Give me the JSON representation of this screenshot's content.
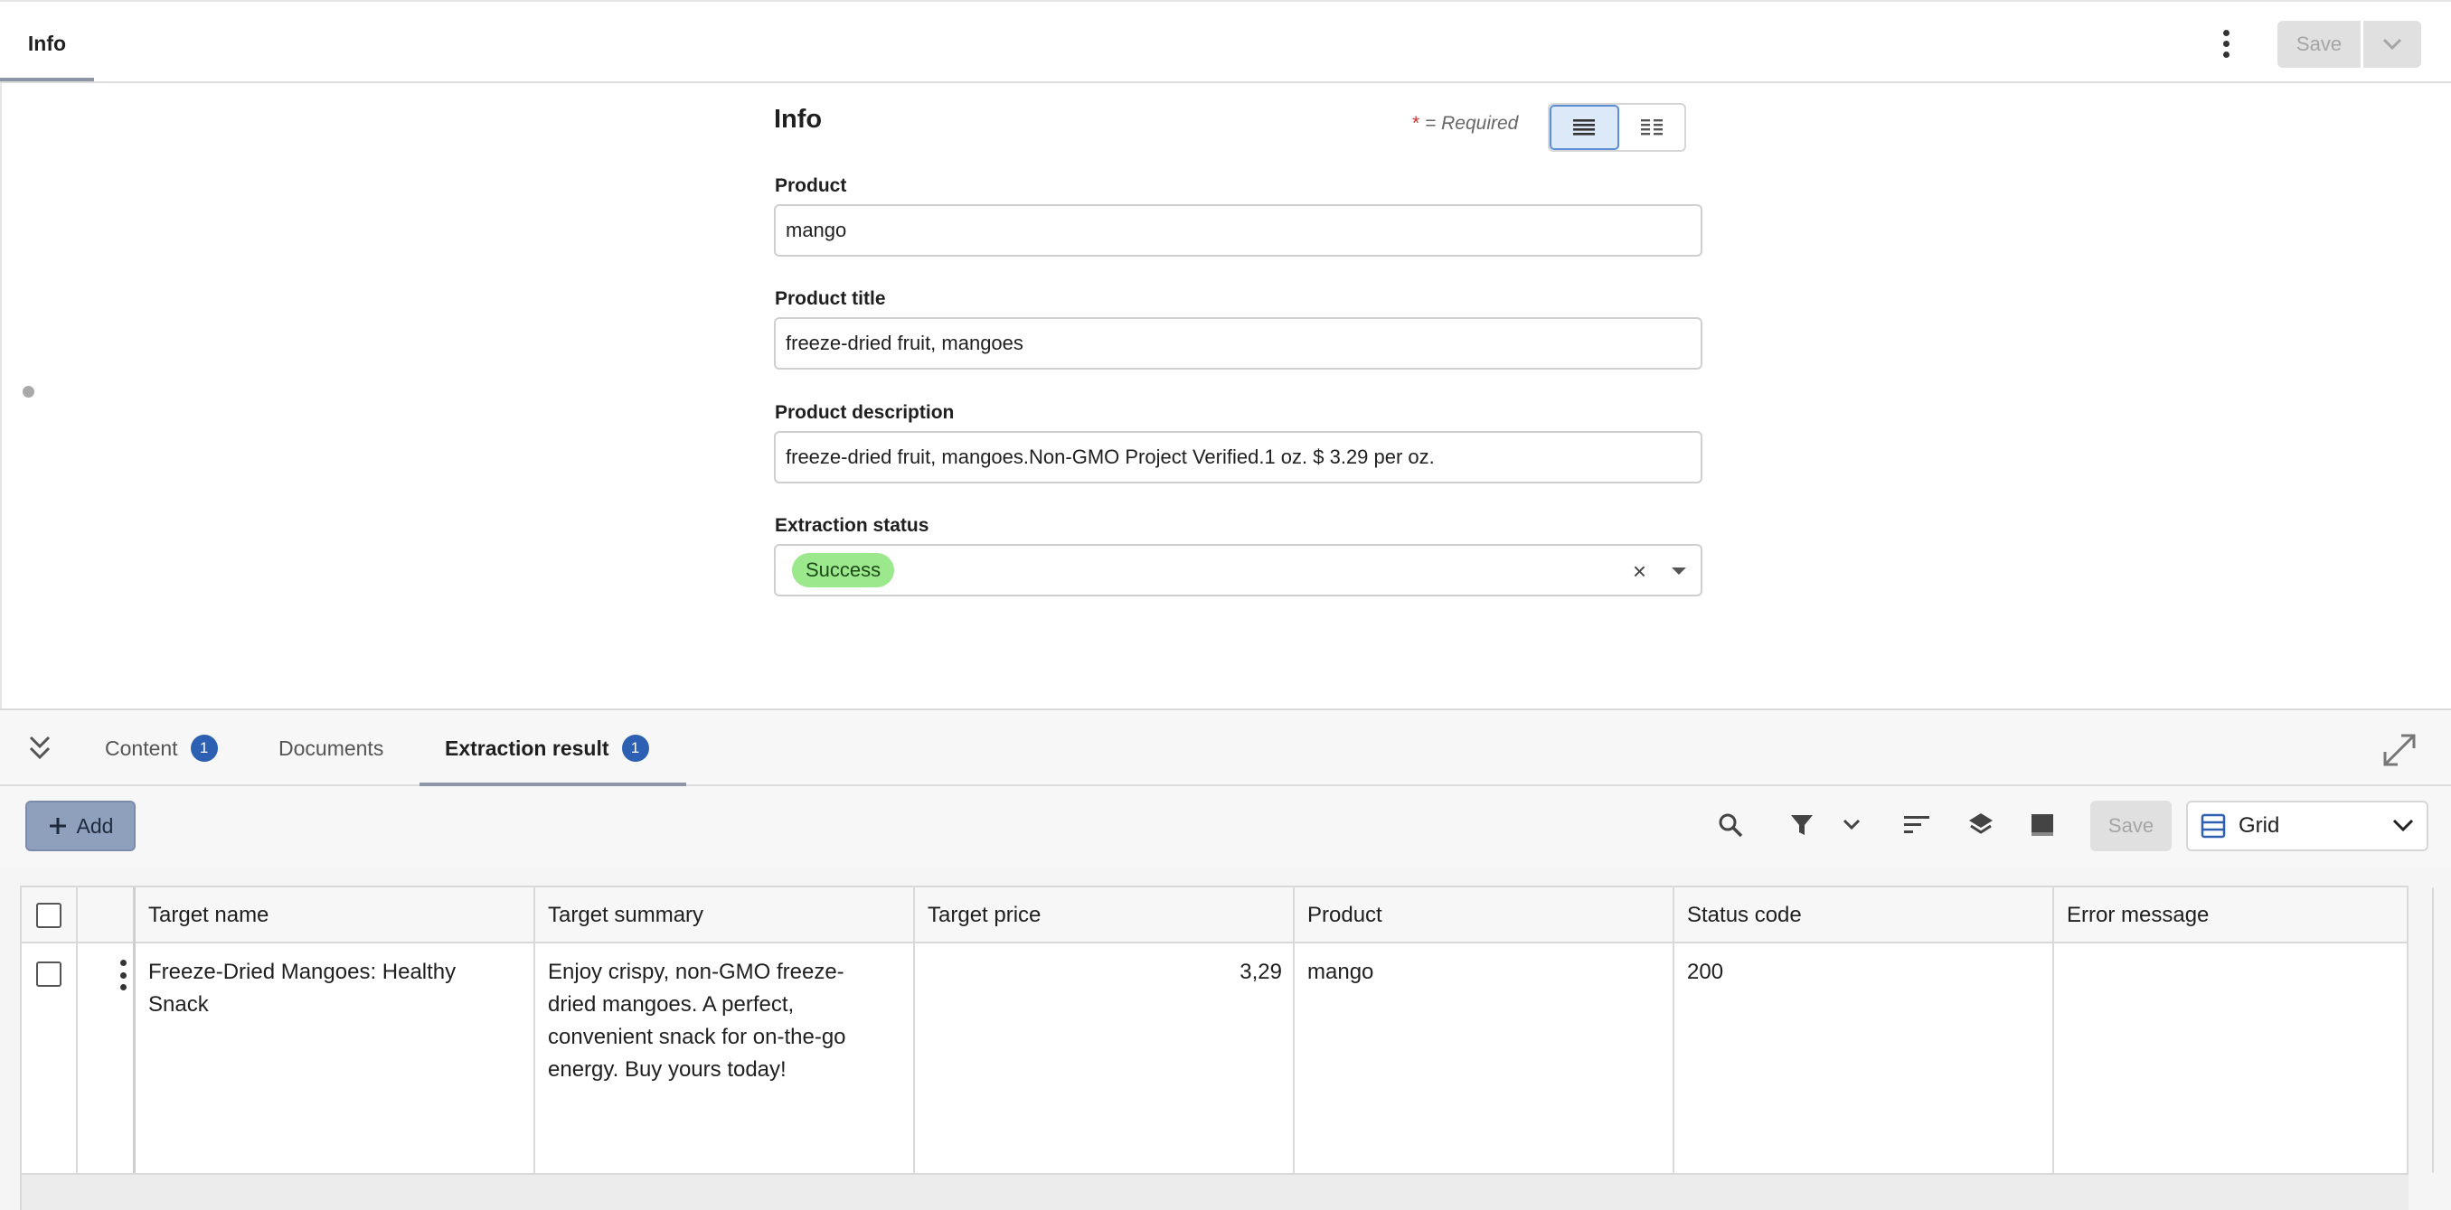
{
  "header": {
    "tab_label": "Info",
    "save_label": "Save"
  },
  "form": {
    "title": "Info",
    "required_star": "*",
    "required_text": " = Required",
    "fields": {
      "product": {
        "label": "Product",
        "value": "mango"
      },
      "product_title": {
        "label": "Product title",
        "value": "freeze-dried fruit, mangoes"
      },
      "product_description": {
        "label": "Product description",
        "value": "freeze-dried fruit, mangoes.Non-GMO Project Verified.1 oz. $ 3.29 per oz."
      },
      "extraction_status": {
        "label": "Extraction status",
        "value": "Success",
        "clear_glyph": "×"
      }
    }
  },
  "bottom": {
    "tabs": [
      {
        "label": "Content",
        "count": "1"
      },
      {
        "label": "Documents"
      },
      {
        "label": "Extraction result",
        "count": "1",
        "active": true
      }
    ],
    "toolbar": {
      "add_label": "Add",
      "save_label": "Save",
      "view_label": "Grid"
    },
    "grid": {
      "columns": [
        "Target name",
        "Target summary",
        "Target price",
        "Product",
        "Status code",
        "Error message"
      ],
      "rows": [
        {
          "target_name": "Freeze-Dried Mangoes: Healthy Snack",
          "target_summary": "Enjoy crispy, non-GMO freeze-dried mangoes. A perfect, convenient snack for on-the-go energy. Buy yours today!",
          "target_price": "3,29",
          "product": "mango",
          "status_code": "200",
          "error_message": ""
        }
      ]
    }
  },
  "colors": {
    "accent": "#2d5fb3",
    "success_badge": "#9be88d",
    "add_button": "#8fa0bd"
  }
}
